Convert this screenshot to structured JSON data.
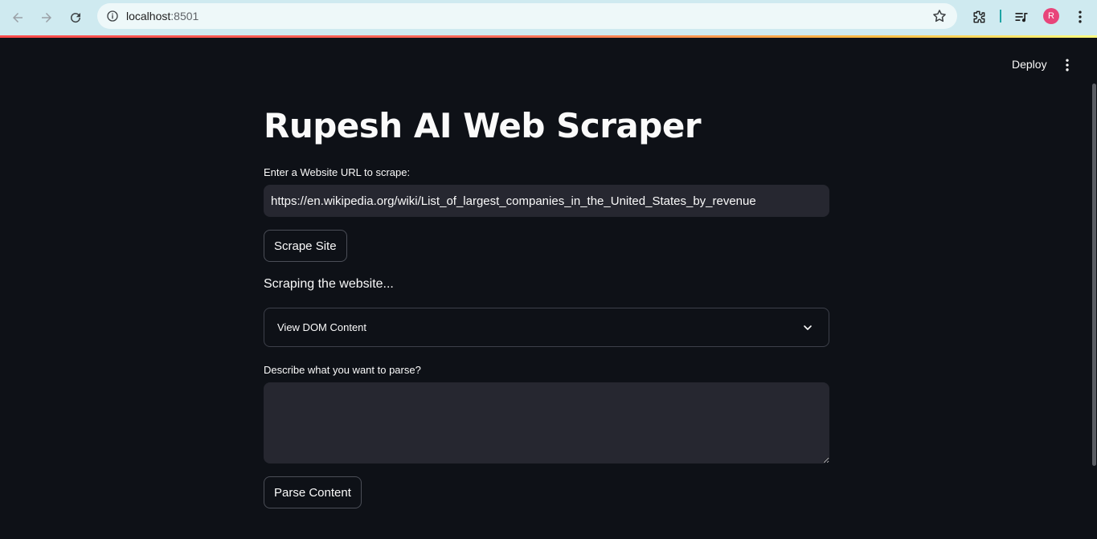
{
  "browser": {
    "url_host": "localhost",
    "url_port": ":8501",
    "avatar_letter": "R",
    "icons": [
      "back-arrow-icon",
      "forward-arrow-icon",
      "reload-icon",
      "site-info-icon",
      "bookmark-star-icon",
      "extensions-icon",
      "media-controls-icon",
      "profile-avatar",
      "more-vert-icon"
    ]
  },
  "header": {
    "deploy_label": "Deploy"
  },
  "main": {
    "title": "Rupesh AI Web Scraper",
    "url_label": "Enter a Website URL to scrape:",
    "url_value": "https://en.wikipedia.org/wiki/List_of_largest_companies_in_the_United_States_by_revenue",
    "scrape_button": "Scrape Site",
    "status_text": "Scraping the website...",
    "expander_label": "View DOM Content",
    "parse_label": "Describe what you want to parse?",
    "parse_value": "",
    "parse_button": "Parse Content"
  },
  "colors": {
    "background": "#0e1117",
    "input_bg": "#262730",
    "text": "#fafafa",
    "accent_bar": "#ff4b4b"
  }
}
